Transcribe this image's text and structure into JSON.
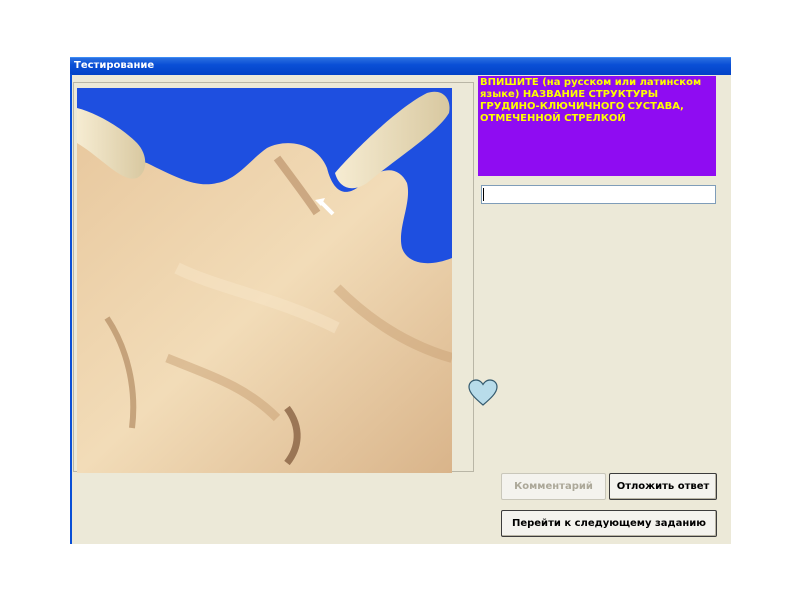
{
  "window": {
    "title": "Тестирование"
  },
  "question": {
    "text": "ВПИШИТЕ (на русском или латинском языке) НАЗВАНИЕ СТРУКТУРЫ ГРУДИНО-КЛЮЧИЧНОГО СУСТАВА, ОТМЕЧЕННОЙ СТРЕЛКОЙ",
    "background_color": "#8f0cf2",
    "text_color": "#ffff00"
  },
  "answer": {
    "value": "",
    "placeholder": ""
  },
  "buttons": {
    "comment_label": "Комментарий",
    "comment_enabled": false,
    "postpone_label": "Отложить ответ",
    "next_label": "Перейти к следующему заданию"
  },
  "image": {
    "subject": "anatomical specimen photo",
    "marker": "white arrow"
  },
  "icons": {
    "heart": "heart-icon"
  },
  "colors": {
    "titlebar": "#0a4fd6",
    "window_bg": "#ece9d8",
    "photo_bg": "#1e4fe0"
  }
}
